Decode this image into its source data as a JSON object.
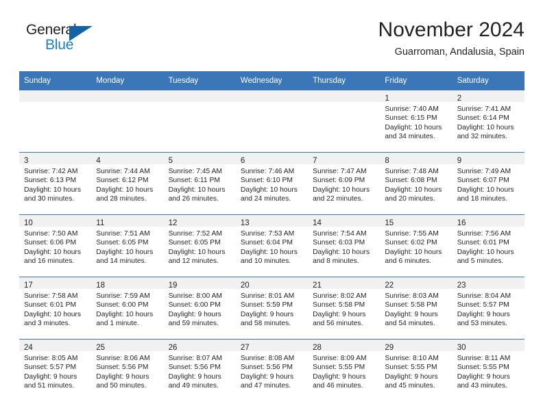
{
  "brand": {
    "name_part1": "General",
    "name_part2": "Blue",
    "color_dark": "#231f20",
    "color_blue": "#1b7fc3",
    "triangle_color": "#1362a4"
  },
  "header": {
    "title": "November 2024",
    "subtitle": "Guarroman, Andalusia, Spain"
  },
  "theme": {
    "header_blue": "#3b77b8",
    "daynum_band": "#f1f1f1",
    "text": "#231f20"
  },
  "weekdays": [
    "Sunday",
    "Monday",
    "Tuesday",
    "Wednesday",
    "Thursday",
    "Friday",
    "Saturday"
  ],
  "weeks": [
    [
      {
        "empty": true
      },
      {
        "empty": true
      },
      {
        "empty": true
      },
      {
        "empty": true
      },
      {
        "empty": true
      },
      {
        "empty": false,
        "day": "1",
        "sunrise": "Sunrise: 7:40 AM",
        "sunset": "Sunset: 6:15 PM",
        "daylight1": "Daylight: 10 hours",
        "daylight2": "and 34 minutes."
      },
      {
        "empty": false,
        "day": "2",
        "sunrise": "Sunrise: 7:41 AM",
        "sunset": "Sunset: 6:14 PM",
        "daylight1": "Daylight: 10 hours",
        "daylight2": "and 32 minutes."
      }
    ],
    [
      {
        "empty": false,
        "day": "3",
        "sunrise": "Sunrise: 7:42 AM",
        "sunset": "Sunset: 6:13 PM",
        "daylight1": "Daylight: 10 hours",
        "daylight2": "and 30 minutes."
      },
      {
        "empty": false,
        "day": "4",
        "sunrise": "Sunrise: 7:44 AM",
        "sunset": "Sunset: 6:12 PM",
        "daylight1": "Daylight: 10 hours",
        "daylight2": "and 28 minutes."
      },
      {
        "empty": false,
        "day": "5",
        "sunrise": "Sunrise: 7:45 AM",
        "sunset": "Sunset: 6:11 PM",
        "daylight1": "Daylight: 10 hours",
        "daylight2": "and 26 minutes."
      },
      {
        "empty": false,
        "day": "6",
        "sunrise": "Sunrise: 7:46 AM",
        "sunset": "Sunset: 6:10 PM",
        "daylight1": "Daylight: 10 hours",
        "daylight2": "and 24 minutes."
      },
      {
        "empty": false,
        "day": "7",
        "sunrise": "Sunrise: 7:47 AM",
        "sunset": "Sunset: 6:09 PM",
        "daylight1": "Daylight: 10 hours",
        "daylight2": "and 22 minutes."
      },
      {
        "empty": false,
        "day": "8",
        "sunrise": "Sunrise: 7:48 AM",
        "sunset": "Sunset: 6:08 PM",
        "daylight1": "Daylight: 10 hours",
        "daylight2": "and 20 minutes."
      },
      {
        "empty": false,
        "day": "9",
        "sunrise": "Sunrise: 7:49 AM",
        "sunset": "Sunset: 6:07 PM",
        "daylight1": "Daylight: 10 hours",
        "daylight2": "and 18 minutes."
      }
    ],
    [
      {
        "empty": false,
        "day": "10",
        "sunrise": "Sunrise: 7:50 AM",
        "sunset": "Sunset: 6:06 PM",
        "daylight1": "Daylight: 10 hours",
        "daylight2": "and 16 minutes."
      },
      {
        "empty": false,
        "day": "11",
        "sunrise": "Sunrise: 7:51 AM",
        "sunset": "Sunset: 6:05 PM",
        "daylight1": "Daylight: 10 hours",
        "daylight2": "and 14 minutes."
      },
      {
        "empty": false,
        "day": "12",
        "sunrise": "Sunrise: 7:52 AM",
        "sunset": "Sunset: 6:05 PM",
        "daylight1": "Daylight: 10 hours",
        "daylight2": "and 12 minutes."
      },
      {
        "empty": false,
        "day": "13",
        "sunrise": "Sunrise: 7:53 AM",
        "sunset": "Sunset: 6:04 PM",
        "daylight1": "Daylight: 10 hours",
        "daylight2": "and 10 minutes."
      },
      {
        "empty": false,
        "day": "14",
        "sunrise": "Sunrise: 7:54 AM",
        "sunset": "Sunset: 6:03 PM",
        "daylight1": "Daylight: 10 hours",
        "daylight2": "and 8 minutes."
      },
      {
        "empty": false,
        "day": "15",
        "sunrise": "Sunrise: 7:55 AM",
        "sunset": "Sunset: 6:02 PM",
        "daylight1": "Daylight: 10 hours",
        "daylight2": "and 6 minutes."
      },
      {
        "empty": false,
        "day": "16",
        "sunrise": "Sunrise: 7:56 AM",
        "sunset": "Sunset: 6:01 PM",
        "daylight1": "Daylight: 10 hours",
        "daylight2": "and 5 minutes."
      }
    ],
    [
      {
        "empty": false,
        "day": "17",
        "sunrise": "Sunrise: 7:58 AM",
        "sunset": "Sunset: 6:01 PM",
        "daylight1": "Daylight: 10 hours",
        "daylight2": "and 3 minutes."
      },
      {
        "empty": false,
        "day": "18",
        "sunrise": "Sunrise: 7:59 AM",
        "sunset": "Sunset: 6:00 PM",
        "daylight1": "Daylight: 10 hours",
        "daylight2": "and 1 minute."
      },
      {
        "empty": false,
        "day": "19",
        "sunrise": "Sunrise: 8:00 AM",
        "sunset": "Sunset: 6:00 PM",
        "daylight1": "Daylight: 9 hours",
        "daylight2": "and 59 minutes."
      },
      {
        "empty": false,
        "day": "20",
        "sunrise": "Sunrise: 8:01 AM",
        "sunset": "Sunset: 5:59 PM",
        "daylight1": "Daylight: 9 hours",
        "daylight2": "and 58 minutes."
      },
      {
        "empty": false,
        "day": "21",
        "sunrise": "Sunrise: 8:02 AM",
        "sunset": "Sunset: 5:58 PM",
        "daylight1": "Daylight: 9 hours",
        "daylight2": "and 56 minutes."
      },
      {
        "empty": false,
        "day": "22",
        "sunrise": "Sunrise: 8:03 AM",
        "sunset": "Sunset: 5:58 PM",
        "daylight1": "Daylight: 9 hours",
        "daylight2": "and 54 minutes."
      },
      {
        "empty": false,
        "day": "23",
        "sunrise": "Sunrise: 8:04 AM",
        "sunset": "Sunset: 5:57 PM",
        "daylight1": "Daylight: 9 hours",
        "daylight2": "and 53 minutes."
      }
    ],
    [
      {
        "empty": false,
        "day": "24",
        "sunrise": "Sunrise: 8:05 AM",
        "sunset": "Sunset: 5:57 PM",
        "daylight1": "Daylight: 9 hours",
        "daylight2": "and 51 minutes."
      },
      {
        "empty": false,
        "day": "25",
        "sunrise": "Sunrise: 8:06 AM",
        "sunset": "Sunset: 5:56 PM",
        "daylight1": "Daylight: 9 hours",
        "daylight2": "and 50 minutes."
      },
      {
        "empty": false,
        "day": "26",
        "sunrise": "Sunrise: 8:07 AM",
        "sunset": "Sunset: 5:56 PM",
        "daylight1": "Daylight: 9 hours",
        "daylight2": "and 49 minutes."
      },
      {
        "empty": false,
        "day": "27",
        "sunrise": "Sunrise: 8:08 AM",
        "sunset": "Sunset: 5:56 PM",
        "daylight1": "Daylight: 9 hours",
        "daylight2": "and 47 minutes."
      },
      {
        "empty": false,
        "day": "28",
        "sunrise": "Sunrise: 8:09 AM",
        "sunset": "Sunset: 5:55 PM",
        "daylight1": "Daylight: 9 hours",
        "daylight2": "and 46 minutes."
      },
      {
        "empty": false,
        "day": "29",
        "sunrise": "Sunrise: 8:10 AM",
        "sunset": "Sunset: 5:55 PM",
        "daylight1": "Daylight: 9 hours",
        "daylight2": "and 45 minutes."
      },
      {
        "empty": false,
        "day": "30",
        "sunrise": "Sunrise: 8:11 AM",
        "sunset": "Sunset: 5:55 PM",
        "daylight1": "Daylight: 9 hours",
        "daylight2": "and 43 minutes."
      }
    ]
  ]
}
